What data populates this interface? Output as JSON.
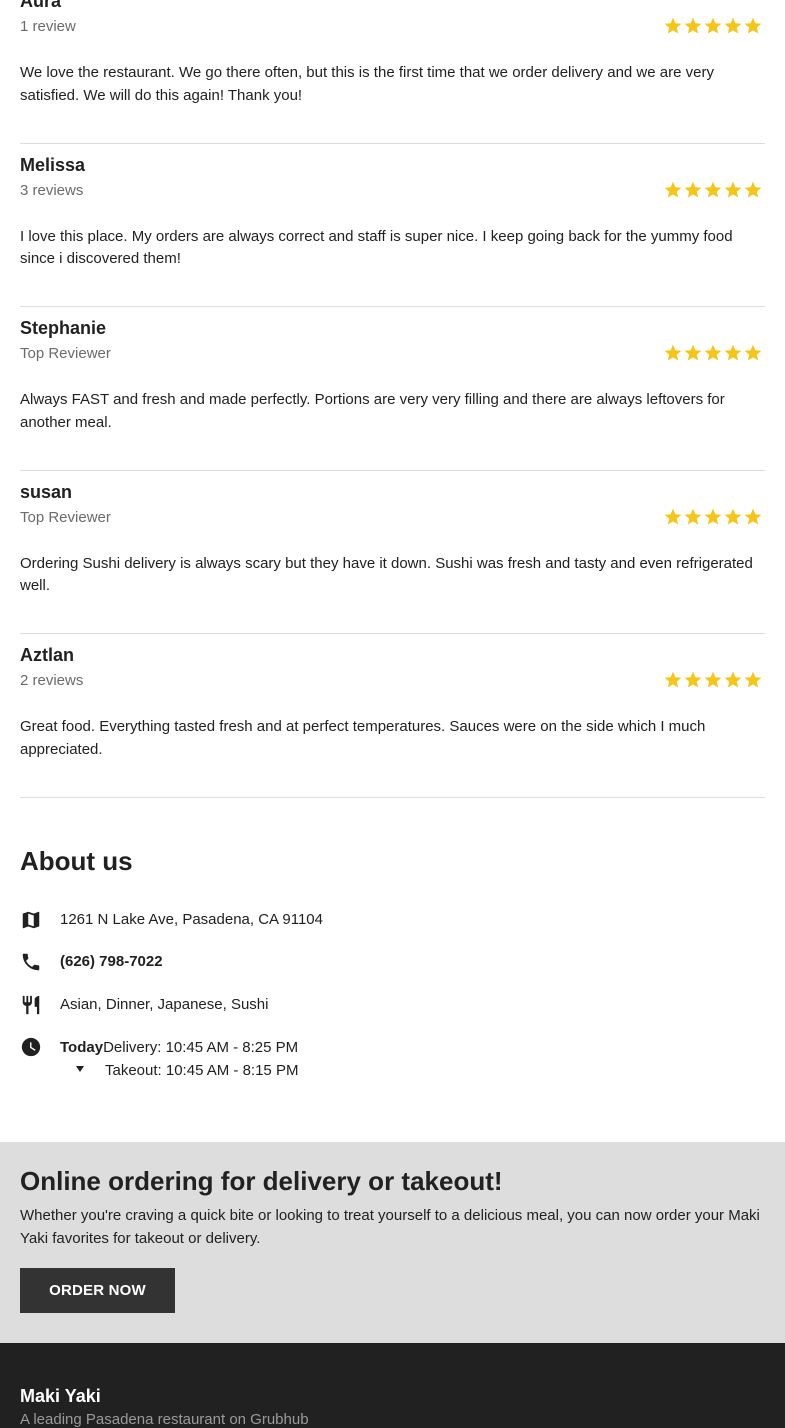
{
  "reviews": [
    {
      "name": "Aura",
      "meta": "1 review",
      "rating": 5,
      "text": "We love the restaurant. We go there often, but this is the first time that we order delivery and we are very satisfied. We will do this again! Thank you!"
    },
    {
      "name": "Melissa",
      "meta": "3 reviews",
      "rating": 5,
      "text": "I love this place. My orders are always correct and staff is super nice. I keep going back for the yummy food since i discovered them!"
    },
    {
      "name": "Stephanie",
      "meta": "Top Reviewer",
      "rating": 5,
      "text": "Always FAST and fresh and made perfectly. Portions are very very filling and there are always leftovers for another meal."
    },
    {
      "name": "susan",
      "meta": "Top Reviewer",
      "rating": 5,
      "text": "Ordering Sushi delivery is always scary but they have it down. Sushi was fresh and tasty and even refrigerated well."
    },
    {
      "name": "Aztlan",
      "meta": "2 reviews",
      "rating": 5,
      "text": "Great food. Everything tasted fresh and at perfect temperatures. Sauces were on the side which I much appreciated."
    }
  ],
  "about": {
    "title": "About us",
    "address": "1261 N Lake Ave, Pasadena, CA 91104",
    "phone": "(626) 798-7022",
    "cuisines": "Asian, Dinner, Japanese, Sushi",
    "hours": {
      "today_label": "Today",
      "delivery": "Delivery: 10:45 AM - 8:25 PM",
      "takeout": "Takeout: 10:45 AM - 8:15 PM"
    },
    "icons": {
      "address": "map-icon",
      "phone": "phone-icon",
      "cuisines": "fork-knife-icon",
      "hours": "clock-icon",
      "hours_toggle": "caret-down-icon"
    }
  },
  "cta": {
    "title": "Online ordering for delivery or takeout!",
    "text": "Whether you're craving a quick bite or looking to treat yourself to a delicious meal, you can now order your Maki Yaki favorites for takeout or delivery.",
    "button_label": "ORDER NOW"
  },
  "footer": {
    "name": "Maki Yaki",
    "tagline": "A leading Pasadena restaurant on Grubhub"
  },
  "colors": {
    "star": "#f5c518",
    "cta_bg": "#dddddd",
    "button_bg": "#333333",
    "footer_bg": "#212121"
  }
}
